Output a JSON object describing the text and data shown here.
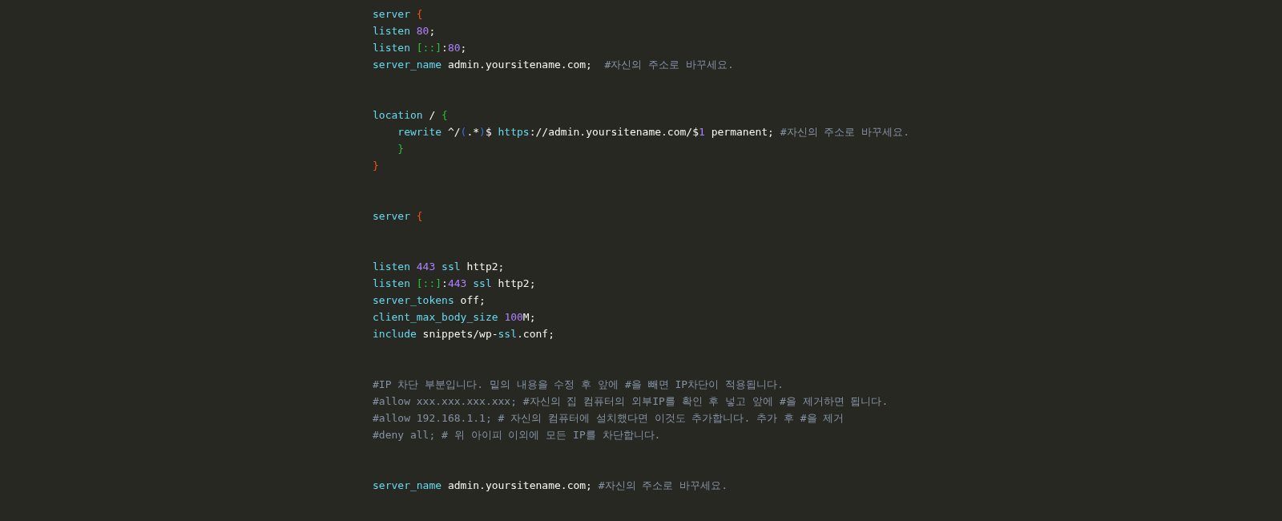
{
  "code_block": {
    "blocks": [
      {
        "lines": [
          {
            "tokens": [
              {
                "text": "server ",
                "kind": "directive"
              },
              {
                "text": "{",
                "kind": "brace"
              }
            ]
          },
          {
            "tokens": [
              {
                "text": "listen ",
                "kind": "directive"
              },
              {
                "text": "80",
                "kind": "number"
              },
              {
                "text": ";",
                "kind": "text"
              }
            ]
          },
          {
            "tokens": [
              {
                "text": "listen ",
                "kind": "directive"
              },
              {
                "text": "[::]",
                "kind": "bracket"
              },
              {
                "text": ":",
                "kind": "text"
              },
              {
                "text": "80",
                "kind": "number"
              },
              {
                "text": ";",
                "kind": "text"
              }
            ]
          },
          {
            "tokens": [
              {
                "text": "server_name",
                "kind": "directive"
              },
              {
                "text": " admin.yoursitename.com;  ",
                "kind": "text"
              },
              {
                "text": "#자신의 주소로 바꾸세요.",
                "kind": "comment"
              }
            ]
          }
        ]
      },
      {
        "lines": [
          {
            "tokens": [
              {
                "text": "location",
                "kind": "directive"
              },
              {
                "text": " / ",
                "kind": "text"
              },
              {
                "text": "{",
                "kind": "bracket"
              }
            ]
          },
          {
            "tokens": [
              {
                "text": "    rewrite",
                "kind": "directive"
              },
              {
                "text": " ^/",
                "kind": "text"
              },
              {
                "text": "(",
                "kind": "paren"
              },
              {
                "text": ".*",
                "kind": "text"
              },
              {
                "text": ")",
                "kind": "paren"
              },
              {
                "text": "$ ",
                "kind": "text"
              },
              {
                "text": "https",
                "kind": "directive"
              },
              {
                "text": "://admin.yoursitename.com/$",
                "kind": "text"
              },
              {
                "text": "1",
                "kind": "number"
              },
              {
                "text": " permanent; ",
                "kind": "text"
              },
              {
                "text": "#자신의 주소로 바꾸세요.",
                "kind": "comment"
              }
            ]
          },
          {
            "tokens": [
              {
                "text": "    }",
                "kind": "bracket"
              }
            ]
          },
          {
            "tokens": [
              {
                "text": "}",
                "kind": "brace"
              }
            ]
          }
        ]
      },
      {
        "lines": [
          {
            "tokens": [
              {
                "text": "server ",
                "kind": "directive"
              },
              {
                "text": "{",
                "kind": "brace"
              }
            ]
          }
        ]
      },
      {
        "lines": [
          {
            "tokens": [
              {
                "text": "listen ",
                "kind": "directive"
              },
              {
                "text": "443 ",
                "kind": "number"
              },
              {
                "text": "ssl",
                "kind": "directive"
              },
              {
                "text": " http2;",
                "kind": "text"
              }
            ]
          },
          {
            "tokens": [
              {
                "text": "listen ",
                "kind": "directive"
              },
              {
                "text": "[::]",
                "kind": "bracket"
              },
              {
                "text": ":",
                "kind": "text"
              },
              {
                "text": "443 ",
                "kind": "number"
              },
              {
                "text": "ssl",
                "kind": "directive"
              },
              {
                "text": " http2;",
                "kind": "text"
              }
            ]
          },
          {
            "tokens": [
              {
                "text": "server_tokens",
                "kind": "directive"
              },
              {
                "text": " off;",
                "kind": "text"
              }
            ]
          },
          {
            "tokens": [
              {
                "text": "client_max_body_size ",
                "kind": "directive"
              },
              {
                "text": "100",
                "kind": "number"
              },
              {
                "text": "M;",
                "kind": "text"
              }
            ]
          },
          {
            "tokens": [
              {
                "text": "include",
                "kind": "directive"
              },
              {
                "text": " snippets/wp-",
                "kind": "text"
              },
              {
                "text": "ssl",
                "kind": "directive"
              },
              {
                "text": ".conf;",
                "kind": "text"
              }
            ]
          }
        ]
      },
      {
        "lines": [
          {
            "tokens": [
              {
                "text": "#IP 차단 부분입니다. 밑의 내용을 수정 후 앞에 #을 빼면 IP차단이 적용됩니다.",
                "kind": "comment"
              }
            ]
          },
          {
            "tokens": [
              {
                "text": "#allow xxx.xxx.xxx.xxx; #자신의 집 컴퓨터의 외부IP를 확인 후 넣고 앞에 #을 제거하면 됩니다.",
                "kind": "comment"
              }
            ]
          },
          {
            "tokens": [
              {
                "text": "#allow 192.168.1.1; # 자신의 컴퓨터에 설치했다면 이것도 추가합니다. 추가 후 #을 제거",
                "kind": "comment"
              }
            ]
          },
          {
            "tokens": [
              {
                "text": "#deny all; # 위 아이피 이외에 모든 IP를 차단합니다.",
                "kind": "comment"
              }
            ]
          }
        ]
      },
      {
        "lines": [
          {
            "tokens": [
              {
                "text": "server_name",
                "kind": "directive"
              },
              {
                "text": " admin.yoursitename.com; ",
                "kind": "text"
              },
              {
                "text": "#자신의 주소로 바꾸세요.",
                "kind": "comment"
              }
            ]
          }
        ]
      }
    ]
  }
}
